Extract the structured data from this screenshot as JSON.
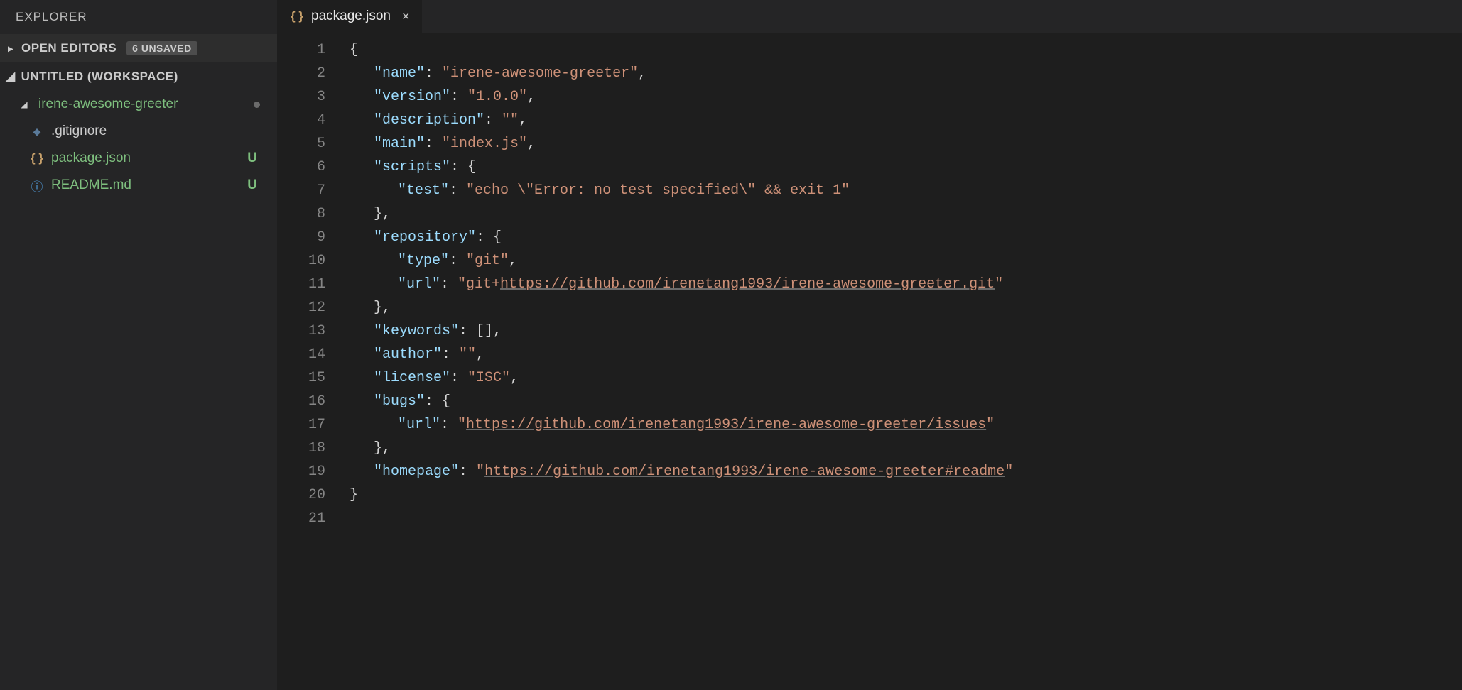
{
  "explorer": {
    "title": "EXPLORER",
    "openEditors": {
      "label": "OPEN EDITORS",
      "badge": "6 UNSAVED"
    },
    "workspace": {
      "label": "UNTITLED (WORKSPACE)"
    },
    "folder": {
      "name": "irene-awesome-greeter"
    },
    "files": [
      {
        "name": ".gitignore",
        "icon": "diamond",
        "status": "",
        "colorClass": "file-default"
      },
      {
        "name": "package.json",
        "icon": "braces",
        "status": "U",
        "colorClass": "file-green"
      },
      {
        "name": "README.md",
        "icon": "info",
        "status": "U",
        "colorClass": "file-green"
      }
    ]
  },
  "tab": {
    "filename": "package.json",
    "close": "×"
  },
  "code": {
    "lineCount": 21,
    "lines": [
      [
        {
          "cls": "t-brace",
          "txt": "{"
        }
      ],
      [
        {
          "indent": 1
        },
        {
          "cls": "t-key",
          "txt": "\"name\""
        },
        {
          "cls": "t-punc",
          "txt": ": "
        },
        {
          "cls": "t-str",
          "txt": "\"irene-awesome-greeter\""
        },
        {
          "cls": "t-punc",
          "txt": ","
        }
      ],
      [
        {
          "indent": 1
        },
        {
          "cls": "t-key",
          "txt": "\"version\""
        },
        {
          "cls": "t-punc",
          "txt": ": "
        },
        {
          "cls": "t-str",
          "txt": "\"1.0.0\""
        },
        {
          "cls": "t-punc",
          "txt": ","
        }
      ],
      [
        {
          "indent": 1
        },
        {
          "cls": "t-key",
          "txt": "\"description\""
        },
        {
          "cls": "t-punc",
          "txt": ": "
        },
        {
          "cls": "t-str",
          "txt": "\"\""
        },
        {
          "cls": "t-punc",
          "txt": ","
        }
      ],
      [
        {
          "indent": 1
        },
        {
          "cls": "t-key",
          "txt": "\"main\""
        },
        {
          "cls": "t-punc",
          "txt": ": "
        },
        {
          "cls": "t-str",
          "txt": "\"index.js\""
        },
        {
          "cls": "t-punc",
          "txt": ","
        }
      ],
      [
        {
          "indent": 1
        },
        {
          "cls": "t-key",
          "txt": "\"scripts\""
        },
        {
          "cls": "t-punc",
          "txt": ": "
        },
        {
          "cls": "t-brace",
          "txt": "{"
        }
      ],
      [
        {
          "indent": 2
        },
        {
          "cls": "t-key",
          "txt": "\"test\""
        },
        {
          "cls": "t-punc",
          "txt": ": "
        },
        {
          "cls": "t-str",
          "txt": "\"echo \\\"Error: no test specified\\\" && exit 1\""
        }
      ],
      [
        {
          "indent": 1
        },
        {
          "cls": "t-brace",
          "txt": "}"
        },
        {
          "cls": "t-punc",
          "txt": ","
        }
      ],
      [
        {
          "indent": 1
        },
        {
          "cls": "t-key",
          "txt": "\"repository\""
        },
        {
          "cls": "t-punc",
          "txt": ": "
        },
        {
          "cls": "t-brace",
          "txt": "{"
        }
      ],
      [
        {
          "indent": 2
        },
        {
          "cls": "t-key",
          "txt": "\"type\""
        },
        {
          "cls": "t-punc",
          "txt": ": "
        },
        {
          "cls": "t-str",
          "txt": "\"git\""
        },
        {
          "cls": "t-punc",
          "txt": ","
        }
      ],
      [
        {
          "indent": 2
        },
        {
          "cls": "t-key",
          "txt": "\"url\""
        },
        {
          "cls": "t-punc",
          "txt": ": "
        },
        {
          "cls": "t-str",
          "txt": "\"git+"
        },
        {
          "cls": "t-link",
          "txt": "https://github.com/irenetang1993/irene-awesome-greeter.git"
        },
        {
          "cls": "t-str",
          "txt": "\""
        }
      ],
      [
        {
          "indent": 1
        },
        {
          "cls": "t-brace",
          "txt": "}"
        },
        {
          "cls": "t-punc",
          "txt": ","
        }
      ],
      [
        {
          "indent": 1
        },
        {
          "cls": "t-key",
          "txt": "\"keywords\""
        },
        {
          "cls": "t-punc",
          "txt": ": []"
        },
        {
          "cls": "t-punc",
          "txt": ","
        }
      ],
      [
        {
          "indent": 1
        },
        {
          "cls": "t-key",
          "txt": "\"author\""
        },
        {
          "cls": "t-punc",
          "txt": ": "
        },
        {
          "cls": "t-str",
          "txt": "\"\""
        },
        {
          "cls": "t-punc",
          "txt": ","
        }
      ],
      [
        {
          "indent": 1
        },
        {
          "cls": "t-key",
          "txt": "\"license\""
        },
        {
          "cls": "t-punc",
          "txt": ": "
        },
        {
          "cls": "t-str",
          "txt": "\"ISC\""
        },
        {
          "cls": "t-punc",
          "txt": ","
        }
      ],
      [
        {
          "indent": 1
        },
        {
          "cls": "t-key",
          "txt": "\"bugs\""
        },
        {
          "cls": "t-punc",
          "txt": ": "
        },
        {
          "cls": "t-brace",
          "txt": "{"
        }
      ],
      [
        {
          "indent": 2
        },
        {
          "cls": "t-key",
          "txt": "\"url\""
        },
        {
          "cls": "t-punc",
          "txt": ": "
        },
        {
          "cls": "t-str",
          "txt": "\""
        },
        {
          "cls": "t-link",
          "txt": "https://github.com/irenetang1993/irene-awesome-greeter/issues"
        },
        {
          "cls": "t-str",
          "txt": "\""
        }
      ],
      [
        {
          "indent": 1
        },
        {
          "cls": "t-brace",
          "txt": "}"
        },
        {
          "cls": "t-punc",
          "txt": ","
        }
      ],
      [
        {
          "indent": 1
        },
        {
          "cls": "t-key",
          "txt": "\"homepage\""
        },
        {
          "cls": "t-punc",
          "txt": ": "
        },
        {
          "cls": "t-str",
          "txt": "\""
        },
        {
          "cls": "t-link",
          "txt": "https://github.com/irenetang1993/irene-awesome-greeter#readme"
        },
        {
          "cls": "t-str",
          "txt": "\""
        }
      ],
      [
        {
          "cls": "t-brace",
          "txt": "}"
        }
      ],
      []
    ]
  }
}
